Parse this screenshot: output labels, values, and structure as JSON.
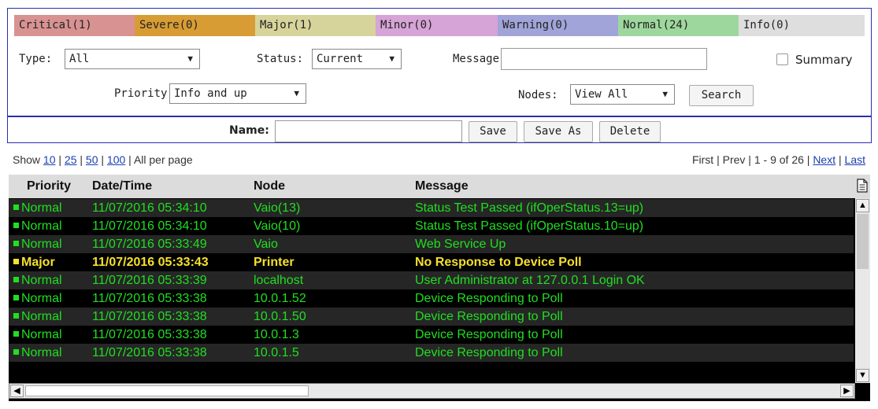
{
  "severity_bar": [
    {
      "label": "Critical(1)",
      "color": "#d89292"
    },
    {
      "label": "Severe(0)",
      "color": "#d89c34"
    },
    {
      "label": "Major(1)",
      "color": "#d6d49a"
    },
    {
      "label": "Minor(0)",
      "color": "#d6a4d6"
    },
    {
      "label": "Warning(0)",
      "color": "#a0a4d8"
    },
    {
      "label": "Normal(24)",
      "color": "#9ed79e"
    },
    {
      "label": "Info(0)",
      "color": "#dedede"
    }
  ],
  "filters": {
    "type_label": "Type:",
    "type_value": "All",
    "status_label": "Status:",
    "status_value": "Current",
    "message_label": "Message:",
    "message_value": "",
    "summary_label": "Summary",
    "priority_label": "Priority:",
    "priority_value": "Info and up",
    "nodes_label": "Nodes:",
    "nodes_value": "View All",
    "search_label": "Search",
    "name_label": "Name:",
    "name_value": "",
    "save_label": "Save",
    "save_as_label": "Save As",
    "delete_label": "Delete"
  },
  "paging": {
    "show_label": "Show",
    "sizes": [
      "10",
      "25",
      "50",
      "100"
    ],
    "all_label": "All per page",
    "first": "First",
    "prev": "Prev",
    "range": "1 - 9 of 26",
    "next": "Next",
    "last": "Last"
  },
  "table": {
    "headers": [
      "Priority",
      "Date/Time",
      "Node",
      "Message"
    ],
    "rows": [
      {
        "priority": "Normal",
        "datetime": "11/07/2016 05:34:10",
        "node": "Vaio(13)",
        "message": "Status Test Passed (ifOperStatus.13=up)"
      },
      {
        "priority": "Normal",
        "datetime": "11/07/2016 05:34:10",
        "node": "Vaio(10)",
        "message": "Status Test Passed (ifOperStatus.10=up)"
      },
      {
        "priority": "Normal",
        "datetime": "11/07/2016 05:33:49",
        "node": "Vaio",
        "message": "Web Service Up"
      },
      {
        "priority": "Major",
        "datetime": "11/07/2016 05:33:43",
        "node": "Printer",
        "message": "No Response to Device Poll"
      },
      {
        "priority": "Normal",
        "datetime": "11/07/2016 05:33:39",
        "node": "localhost",
        "message": "User Administrator at 127.0.0.1 Login OK"
      },
      {
        "priority": "Normal",
        "datetime": "11/07/2016 05:33:38",
        "node": "10.0.1.52",
        "message": "Device Responding to Poll"
      },
      {
        "priority": "Normal",
        "datetime": "11/07/2016 05:33:38",
        "node": "10.0.1.50",
        "message": "Device Responding to Poll"
      },
      {
        "priority": "Normal",
        "datetime": "11/07/2016 05:33:38",
        "node": "10.0.1.3",
        "message": "Device Responding to Poll"
      },
      {
        "priority": "Normal",
        "datetime": "11/07/2016 05:33:38",
        "node": "10.0.1.5",
        "message": "Device Responding to Poll"
      }
    ]
  },
  "icons": {
    "export": "document-icon",
    "scroll_up": "arrow-up-icon",
    "scroll_down": "arrow-down-icon",
    "scroll_left": "arrow-left-icon",
    "scroll_right": "arrow-right-icon"
  }
}
